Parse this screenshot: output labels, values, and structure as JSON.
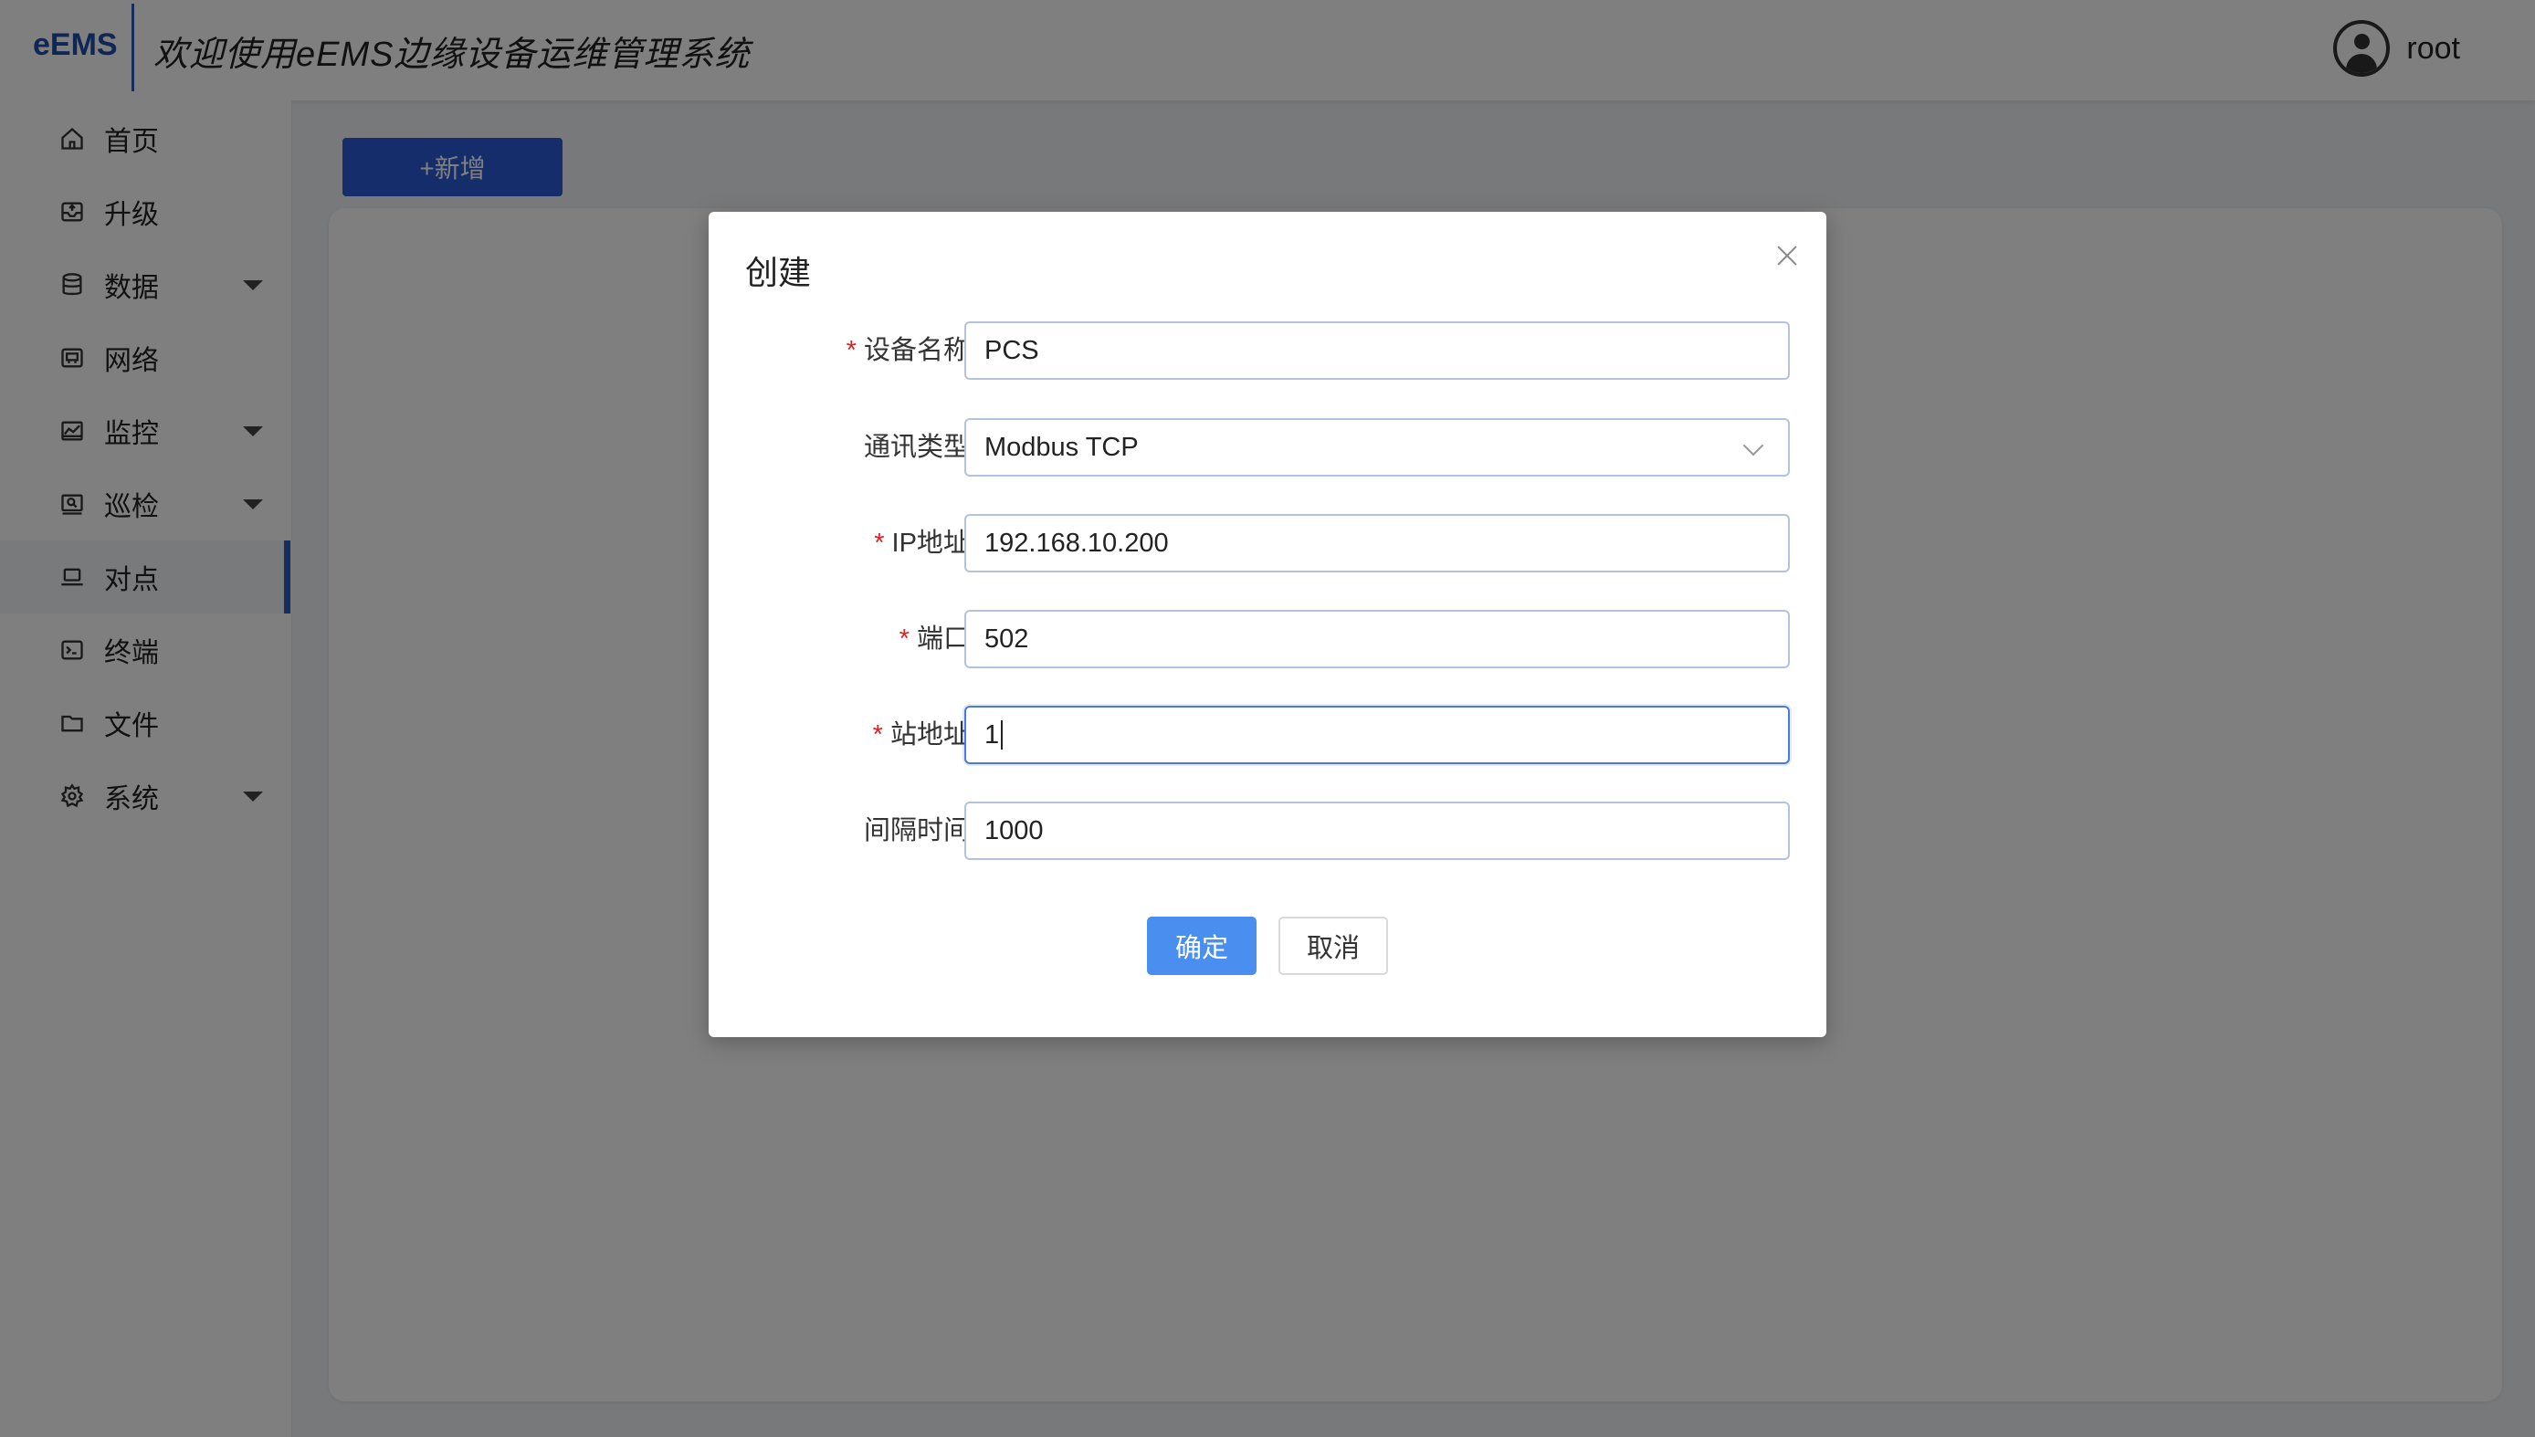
{
  "header": {
    "logo": "eEMS",
    "title": "欢迎使用eEMS边缘设备运维管理系统",
    "user_name": "root"
  },
  "sidebar": {
    "items": [
      {
        "label": "首页",
        "icon": "home-icon",
        "has_submenu": false,
        "active": false
      },
      {
        "label": "升级",
        "icon": "upgrade-icon",
        "has_submenu": false,
        "active": false
      },
      {
        "label": "数据",
        "icon": "database-icon",
        "has_submenu": true,
        "active": false
      },
      {
        "label": "网络",
        "icon": "network-icon",
        "has_submenu": false,
        "active": false
      },
      {
        "label": "监控",
        "icon": "monitor-chart-icon",
        "has_submenu": true,
        "active": false
      },
      {
        "label": "巡检",
        "icon": "inspection-icon",
        "has_submenu": true,
        "active": false
      },
      {
        "label": "对点",
        "icon": "laptop-icon",
        "has_submenu": false,
        "active": true
      },
      {
        "label": "终端",
        "icon": "terminal-icon",
        "has_submenu": false,
        "active": false
      },
      {
        "label": "文件",
        "icon": "folder-icon",
        "has_submenu": false,
        "active": false
      },
      {
        "label": "系统",
        "icon": "gear-icon",
        "has_submenu": true,
        "active": false
      }
    ]
  },
  "toolbar": {
    "add_label": "+新增"
  },
  "modal": {
    "title": "创建",
    "fields": {
      "device_name": {
        "label": "设备名称:",
        "required": true,
        "value": "PCS"
      },
      "comm_type": {
        "label": "通讯类型:",
        "required": false,
        "value": "Modbus TCP"
      },
      "ip": {
        "label": "IP地址:",
        "required": true,
        "value": "192.168.10.200"
      },
      "port": {
        "label": "端口:",
        "required": true,
        "value": "502"
      },
      "station": {
        "label": "站地址:",
        "required": true,
        "value": "1"
      },
      "interval": {
        "label": "间隔时间:",
        "required": false,
        "value": "1000"
      }
    },
    "ok_label": "确定",
    "cancel_label": "取消"
  },
  "colors": {
    "accent": "#2a5cd6",
    "primary_button": "#4a8ef0",
    "required_mark": "#e02020"
  }
}
